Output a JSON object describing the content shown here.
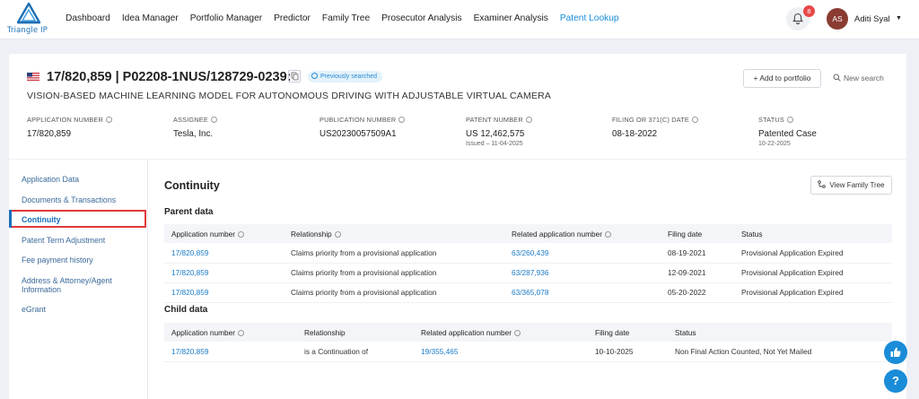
{
  "header": {
    "logo_text": "Triangle IP",
    "nav": [
      {
        "label": "Dashboard",
        "active": false
      },
      {
        "label": "Idea Manager",
        "active": false
      },
      {
        "label": "Portfolio Manager",
        "active": false
      },
      {
        "label": "Predictor",
        "active": false
      },
      {
        "label": "Family Tree",
        "active": false
      },
      {
        "label": "Prosecutor Analysis",
        "active": false
      },
      {
        "label": "Examiner Analysis",
        "active": false
      },
      {
        "label": "Patent Lookup",
        "active": true
      }
    ],
    "notification_count": "8",
    "user_initials": "AS",
    "user_name": "Aditi Syal",
    "caret": "▼",
    "accent_color": "#1a8cd8"
  },
  "patent": {
    "id_line": "17/820,859 | P02208-1NUS/128729-0239:",
    "badge": "Previously searched",
    "add_portfolio": "+ Add to portfolio",
    "new_search": "New search",
    "title": "VISION-BASED MACHINE LEARNING MODEL FOR AUTONOMOUS DRIVING WITH ADJUSTABLE VIRTUAL CAMERA",
    "meta": [
      {
        "label": "APPLICATION NUMBER",
        "value": "17/820,859",
        "sub": ""
      },
      {
        "label": "ASSIGNEE",
        "value": "Tesla, Inc.",
        "sub": ""
      },
      {
        "label": "PUBLICATION NUMBER",
        "value": "US20230057509A1",
        "sub": ""
      },
      {
        "label": "PATENT NUMBER",
        "value": "US 12,462,575",
        "sub": "Issued – 11-04-2025"
      },
      {
        "label": "FILING OR 371(C) DATE",
        "value": "08-18-2022",
        "sub": ""
      },
      {
        "label": "STATUS",
        "value": "Patented Case",
        "sub": "10-22-2025"
      }
    ]
  },
  "sidebar": {
    "items": [
      {
        "label": "Application Data"
      },
      {
        "label": "Documents & Transactions"
      },
      {
        "label": "Continuity"
      },
      {
        "label": "Patent Term Adjustment"
      },
      {
        "label": "Fee payment history"
      },
      {
        "label": "Address & Attorney/Agent Information"
      },
      {
        "label": "eGrant"
      }
    ],
    "active_index": 2
  },
  "continuity": {
    "title": "Continuity",
    "view_family_tree": "View Family Tree",
    "parent_title": "Parent data",
    "parent_headers": [
      "Application number",
      "Relationship",
      "Related application number",
      "Filing date",
      "Status"
    ],
    "parent_rows": [
      [
        "17/820,859",
        "Claims priority from a provisional application",
        "63/260,439",
        "08-19-2021",
        "Provisional Application Expired"
      ],
      [
        "17/820,859",
        "Claims priority from a provisional application",
        "63/287,936",
        "12-09-2021",
        "Provisional Application Expired"
      ],
      [
        "17/820,859",
        "Claims priority from a provisional application",
        "63/365,078",
        "05-20-2022",
        "Provisional Application Expired"
      ]
    ],
    "child_title": "Child data",
    "child_headers": [
      "Application number",
      "Relationship",
      "Related application number",
      "Filing date",
      "Status"
    ],
    "child_rows": [
      [
        "17/820,859",
        "is a Continuation of",
        "19/355,465",
        "10-10-2025",
        "Non Final Action Counted, Not Yet Mailed"
      ]
    ]
  },
  "help_label": "?"
}
